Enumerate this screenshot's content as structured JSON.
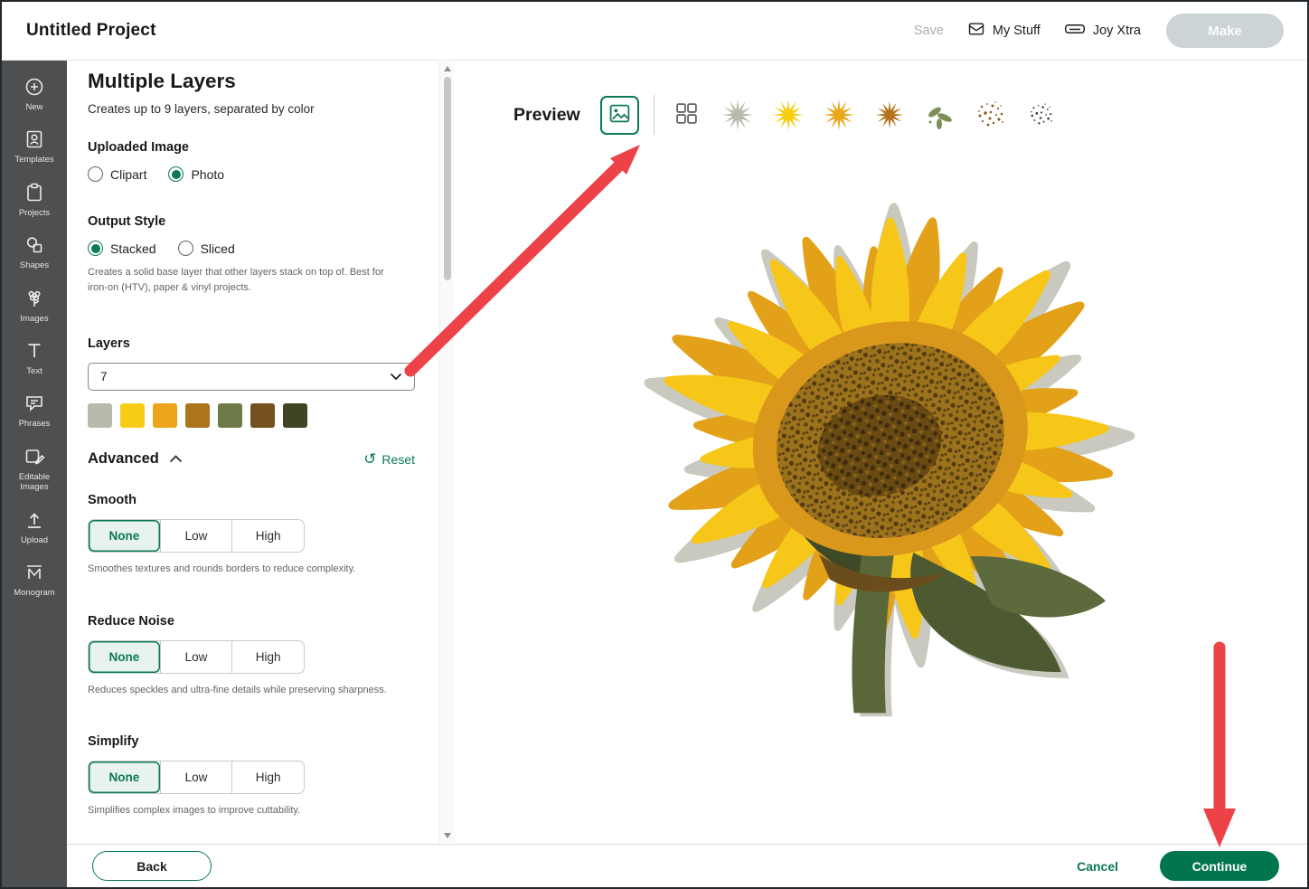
{
  "header": {
    "title": "Untitled Project",
    "save_label": "Save",
    "my_stuff_label": "My Stuff",
    "machine_label": "Joy Xtra",
    "make_label": "Make"
  },
  "sidebar": {
    "items": [
      {
        "label": "New"
      },
      {
        "label": "Templates"
      },
      {
        "label": "Projects"
      },
      {
        "label": "Shapes"
      },
      {
        "label": "Images"
      },
      {
        "label": "Text"
      },
      {
        "label": "Phrases"
      },
      {
        "label": "Editable Images"
      },
      {
        "label": "Upload"
      },
      {
        "label": "Monogram"
      }
    ]
  },
  "panel": {
    "title": "Multiple Layers",
    "subtitle": "Creates up to 9 layers, separated by color",
    "uploaded_image": {
      "label": "Uploaded Image",
      "options": [
        {
          "label": "Clipart",
          "selected": false
        },
        {
          "label": "Photo",
          "selected": true
        }
      ]
    },
    "output_style": {
      "label": "Output Style",
      "options": [
        {
          "label": "Stacked",
          "selected": true
        },
        {
          "label": "Sliced",
          "selected": false
        }
      ],
      "help": "Creates a solid base layer that other layers stack on top of. Best for iron-on (HTV), paper & vinyl projects."
    },
    "layers": {
      "label": "Layers",
      "count": "7",
      "swatches": [
        "#b9b9ae",
        "#f8cc16",
        "#eda41b",
        "#ad741e",
        "#6e7b49",
        "#74511f",
        "#3e4525"
      ]
    },
    "advanced_label": "Advanced",
    "reset_label": "Reset",
    "smooth": {
      "label": "Smooth",
      "options": [
        "None",
        "Low",
        "High"
      ],
      "selected": "None",
      "help": "Smoothes textures and rounds borders to reduce complexity."
    },
    "reduce_noise": {
      "label": "Reduce Noise",
      "options": [
        "None",
        "Low",
        "High"
      ],
      "selected": "None",
      "help": "Reduces speckles and ultra-fine details while preserving sharpness."
    },
    "simplify": {
      "label": "Simplify",
      "options": [
        "None",
        "Low",
        "High"
      ],
      "selected": "None",
      "help": "Simplifies complex images to improve cuttability."
    }
  },
  "preview": {
    "label": "Preview",
    "thumbs": [
      {
        "name": "layer-1",
        "color": "#b9b9ac"
      },
      {
        "name": "layer-2",
        "color": "#f7cd11"
      },
      {
        "name": "layer-3",
        "color": "#eaa61b"
      },
      {
        "name": "layer-4",
        "color": "#b5741c"
      },
      {
        "name": "layer-5",
        "color": "#7d8f58"
      },
      {
        "name": "layer-6",
        "color": "#8a5a22"
      },
      {
        "name": "layer-7",
        "color": "#3f4533"
      }
    ]
  },
  "footer": {
    "back_label": "Back",
    "cancel_label": "Cancel",
    "continue_label": "Continue"
  },
  "colors": {
    "accent_green": "#0b7a52",
    "continue_green": "#00754e",
    "arrow_red": "#ee4249",
    "sidebar_bg": "#4d4f50",
    "disabled_gray": "#ccd4d8"
  }
}
